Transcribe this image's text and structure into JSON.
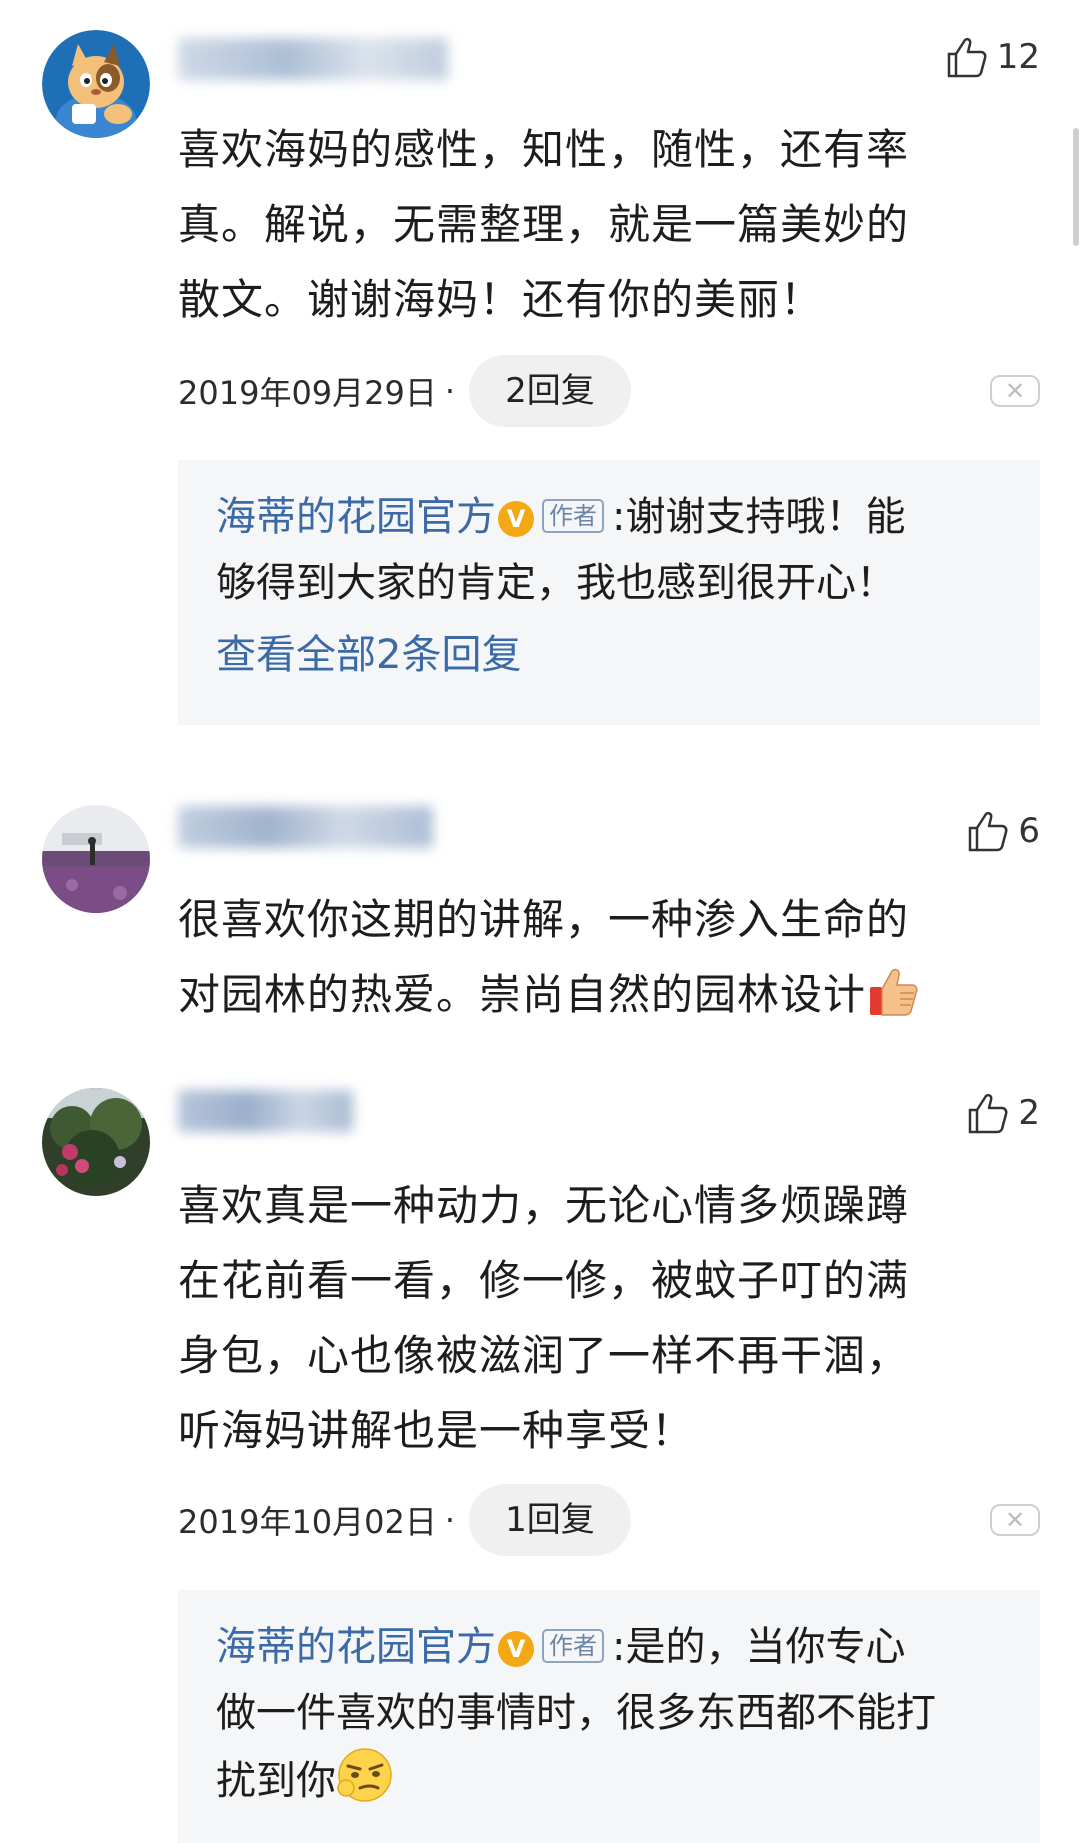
{
  "comments": [
    {
      "likes": "12",
      "lines": [
        "喜欢海妈的感性，知性，随性，还有率",
        "真。解说，无需整理，就是一篇美妙的",
        "散文。谢谢海妈！还有你的美丽！"
      ],
      "date": "2019年09月29日",
      "dot": "·",
      "reply_count": "2回复",
      "reply": {
        "author": "海蒂的花园官方",
        "verified_mark": "V",
        "tag": "作者",
        "line1": ":谢谢支持哦！能",
        "line2": "够得到大家的肯定，我也感到很开心！",
        "view_all": "查看全部2条回复"
      }
    },
    {
      "likes": "6",
      "lines": [
        "很喜欢你这期的讲解，一种渗入生命的",
        "对园林的热爱。崇尚自然的园林设计"
      ]
    },
    {
      "likes": "2",
      "lines": [
        "喜欢真是一种动力，无论心情多烦躁蹲",
        "在花前看一看，修一修，被蚊子叮的满",
        "身包，心也像被滋润了一样不再干涸，",
        "听海妈讲解也是一种享受！"
      ],
      "date": "2019年10月02日",
      "dot": "·",
      "reply_count": "1回复",
      "reply": {
        "author": "海蒂的花园官方",
        "verified_mark": "V",
        "tag": "作者",
        "line1": ":是的，当你专心",
        "line2": "做一件喜欢的事情时，很多东西都不能打",
        "line3": "扰到你"
      }
    }
  ],
  "icons": {
    "like": "thumbs-up-outline-icon",
    "dismiss": "close-icon",
    "verified": "verified-badge-icon",
    "thumbs_up_emoji": "thumbs-up-emoji",
    "smirk_emoji": "smirk-emoji"
  },
  "colors": {
    "link_blue": "#3c6aa6",
    "reply_bg": "#f5f6f8",
    "verified_orange": "#f3a814"
  }
}
